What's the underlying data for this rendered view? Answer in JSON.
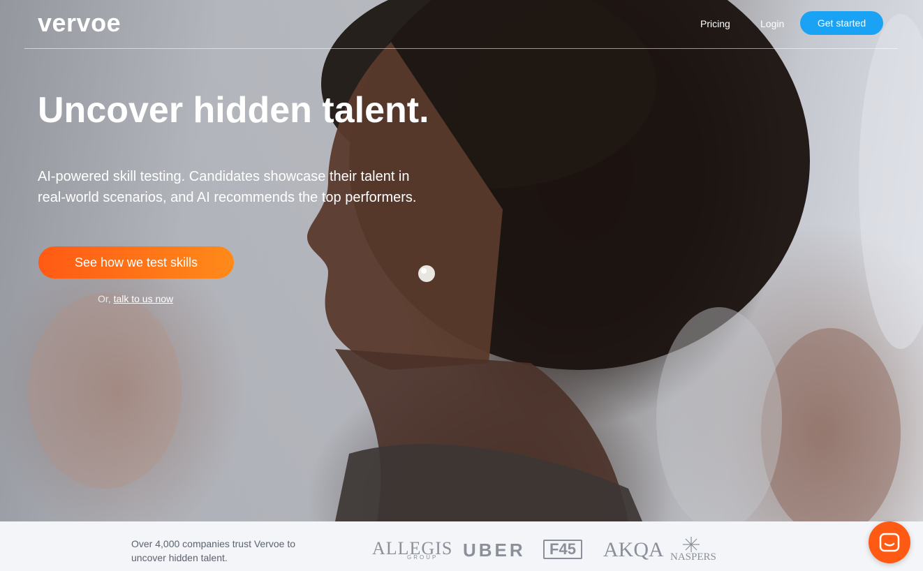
{
  "nav": {
    "logo": "vervoe",
    "pricing": "Pricing",
    "login": "Login",
    "get_started": "Get started"
  },
  "hero": {
    "headline": "Uncover hidden talent.",
    "subtext_line1": "AI-powered skill testing. Candidates showcase their talent in",
    "subtext_line2": "real-world scenarios, and AI recommends the top performers.",
    "cta": "See how we test skills",
    "or_prefix": "Or,",
    "talk_link": "talk to us now"
  },
  "trust": {
    "text_line1": "Over 4,000 companies trust Vervoe to",
    "text_line2": "uncover hidden talent.",
    "logos": {
      "allegis": "ALLEGIS",
      "allegis_sub": "GROUP",
      "uber": "UBER",
      "f45": "F45",
      "akqa": "AKQA",
      "naspers": "NASPERS"
    }
  },
  "chat": {
    "icon": "chat-icon"
  },
  "colors": {
    "accent_blue": "#1aa3f4",
    "accent_orange": "#ff5a14",
    "accent_orange_end": "#ff8a1a"
  }
}
